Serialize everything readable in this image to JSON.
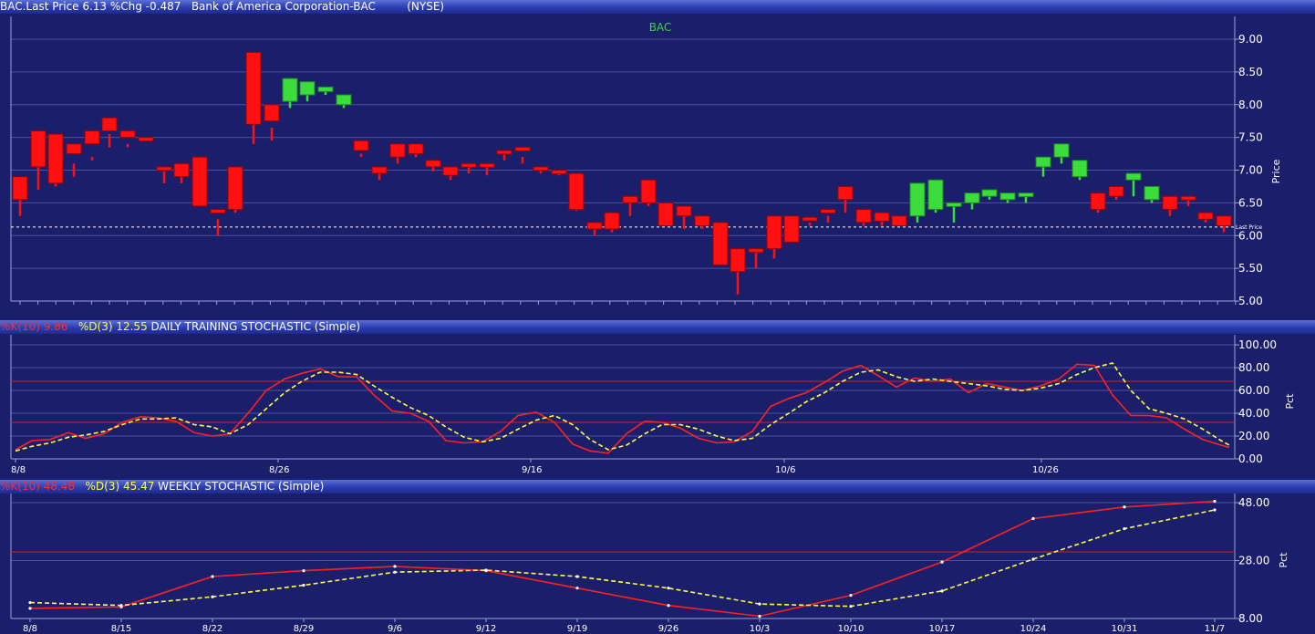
{
  "header": {
    "symbol_line": "BAC.Last Price 6.13 %Chg -0.487",
    "company": "Bank of America Corporation-BAC",
    "exchange": "(NYSE)"
  },
  "price_panel": {
    "title": "BAC",
    "axis_label": "Price",
    "last_price_label": "Last Price",
    "last_price": 6.13,
    "ticks": [
      "9.00",
      "8.50",
      "8.00",
      "7.50",
      "7.00",
      "6.50",
      "6.00",
      "5.50",
      "5.00"
    ]
  },
  "daily_panel": {
    "k_label": "%K(10) 9.86",
    "d_label": "%D(3) 12.55",
    "name": "DAILY TRAINING STOCHASTIC (Simple)",
    "axis_label": "Pct",
    "ticks": [
      "100.00",
      "80.00",
      "60.00",
      "40.00",
      "20.00",
      "0.00"
    ],
    "x_ticks": [
      "8/8",
      "8/26",
      "9/16",
      "10/6",
      "10/26"
    ]
  },
  "weekly_panel": {
    "k_label": "%K(10) 48.48",
    "d_label": "%D(3) 45.47",
    "name": "WEEKLY STOCHASTIC (Simple)",
    "axis_label": "Pct",
    "ticks": [
      "48.00",
      "28.00",
      "8.00"
    ],
    "x_ticks": [
      "8/8",
      "8/15",
      "8/22",
      "8/29",
      "9/6",
      "9/12",
      "9/19",
      "9/26",
      "10/3",
      "10/10",
      "10/17",
      "10/24",
      "10/31",
      "11/7"
    ]
  },
  "colors": {
    "background": "#1b1f6b",
    "up": "#3ddc3d",
    "down": "#ff1010",
    "k_line": "#ff2020",
    "d_line": "#ffff40",
    "title_green": "#3cd23c"
  },
  "chart_data": [
    {
      "type": "candlestick",
      "title": "BAC",
      "ylabel": "Price",
      "ylim": [
        5.0,
        9.0
      ],
      "last_price": 6.13,
      "ohlc": [
        [
          6.55,
          6.9,
          6.3,
          6.9,
          "down"
        ],
        [
          7.05,
          7.6,
          6.7,
          7.6,
          "down"
        ],
        [
          6.8,
          7.55,
          6.75,
          7.55,
          "down"
        ],
        [
          7.25,
          7.4,
          6.9,
          7.1,
          "down"
        ],
        [
          7.4,
          7.6,
          7.15,
          7.2,
          "down"
        ],
        [
          7.6,
          7.8,
          7.35,
          7.55,
          "down"
        ],
        [
          7.5,
          7.6,
          7.35,
          7.4,
          "down"
        ],
        [
          7.5,
          7.5,
          7.4,
          7.4,
          "down"
        ],
        [
          7.0,
          7.05,
          6.8,
          6.98,
          "down"
        ],
        [
          6.9,
          7.1,
          6.8,
          6.9,
          "down"
        ],
        [
          6.45,
          7.2,
          6.45,
          7.2,
          "down"
        ],
        [
          6.35,
          6.4,
          6.0,
          6.25,
          "down"
        ],
        [
          6.4,
          7.05,
          6.35,
          6.95,
          "down"
        ],
        [
          7.7,
          8.8,
          7.4,
          8.3,
          "down"
        ],
        [
          7.75,
          8.0,
          7.45,
          7.65,
          "down"
        ],
        [
          8.05,
          8.4,
          7.95,
          8.35,
          "up"
        ],
        [
          8.15,
          8.35,
          8.05,
          8.3,
          "up"
        ],
        [
          8.2,
          8.27,
          8.15,
          8.25,
          "up"
        ],
        [
          8.0,
          8.15,
          7.95,
          8.15,
          "up"
        ],
        [
          7.3,
          7.45,
          7.2,
          7.25,
          "down"
        ],
        [
          6.95,
          7.05,
          6.85,
          6.95,
          "down"
        ],
        [
          7.2,
          7.4,
          7.1,
          7.4,
          "down"
        ],
        [
          7.25,
          7.4,
          7.2,
          7.35,
          "down"
        ],
        [
          7.05,
          7.15,
          6.98,
          7.05,
          "down"
        ],
        [
          6.92,
          7.05,
          6.85,
          7.02,
          "down"
        ],
        [
          7.05,
          7.1,
          6.95,
          7.05,
          "down"
        ],
        [
          7.05,
          7.1,
          6.92,
          7.05,
          "down"
        ],
        [
          7.25,
          7.3,
          7.15,
          7.3,
          "down"
        ],
        [
          7.3,
          7.35,
          7.1,
          7.2,
          "down"
        ],
        [
          7.0,
          7.05,
          6.95,
          7.0,
          "down"
        ],
        [
          6.95,
          7.0,
          6.92,
          7.0,
          "down"
        ],
        [
          6.4,
          6.95,
          6.38,
          6.95,
          "down"
        ],
        [
          6.1,
          6.2,
          6.0,
          6.15,
          "down"
        ],
        [
          6.1,
          6.35,
          6.05,
          6.25,
          "down"
        ],
        [
          6.5,
          6.6,
          6.3,
          6.5,
          "down"
        ],
        [
          6.5,
          6.85,
          6.45,
          6.8,
          "down"
        ],
        [
          6.15,
          6.5,
          6.15,
          6.5,
          "down"
        ],
        [
          6.3,
          6.45,
          6.1,
          6.35,
          "down"
        ],
        [
          6.15,
          6.3,
          6.1,
          6.15,
          "down"
        ],
        [
          5.55,
          6.2,
          5.55,
          6.1,
          "down"
        ],
        [
          5.45,
          5.8,
          5.1,
          5.7,
          "down"
        ],
        [
          5.75,
          5.8,
          5.5,
          5.75,
          "down"
        ],
        [
          5.8,
          6.3,
          5.65,
          6.25,
          "down"
        ],
        [
          5.9,
          6.3,
          5.9,
          6.3,
          "down"
        ],
        [
          6.25,
          6.28,
          6.15,
          6.2,
          "down"
        ],
        [
          6.35,
          6.4,
          6.2,
          6.3,
          "down"
        ],
        [
          6.55,
          6.75,
          6.35,
          6.6,
          "down"
        ],
        [
          6.2,
          6.4,
          6.15,
          6.4,
          "down"
        ],
        [
          6.22,
          6.35,
          6.15,
          6.25,
          "down"
        ],
        [
          6.15,
          6.3,
          6.1,
          6.1,
          "down"
        ],
        [
          6.3,
          6.8,
          6.2,
          6.6,
          "up"
        ],
        [
          6.4,
          6.85,
          6.35,
          6.7,
          "up"
        ],
        [
          6.45,
          6.5,
          6.2,
          6.45,
          "up"
        ],
        [
          6.5,
          6.65,
          6.4,
          6.55,
          "up"
        ],
        [
          6.6,
          6.7,
          6.55,
          6.65,
          "up"
        ],
        [
          6.55,
          6.65,
          6.5,
          6.65,
          "up"
        ],
        [
          6.6,
          6.65,
          6.5,
          6.6,
          "up"
        ],
        [
          7.05,
          7.2,
          6.9,
          7.1,
          "up"
        ],
        [
          7.2,
          7.4,
          7.1,
          7.35,
          "up"
        ],
        [
          6.9,
          7.15,
          6.85,
          7.05,
          "up"
        ],
        [
          6.4,
          6.65,
          6.35,
          6.4,
          "down"
        ],
        [
          6.6,
          6.75,
          6.55,
          6.7,
          "down"
        ],
        [
          6.85,
          6.95,
          6.6,
          6.85,
          "up"
        ],
        [
          6.55,
          6.75,
          6.5,
          6.7,
          "up"
        ],
        [
          6.4,
          6.6,
          6.3,
          6.5,
          "down"
        ],
        [
          6.55,
          6.6,
          6.45,
          6.55,
          "down"
        ],
        [
          6.25,
          6.35,
          6.2,
          6.3,
          "down"
        ],
        [
          6.15,
          6.3,
          6.05,
          6.3,
          "down"
        ]
      ],
      "x_positions": [
        22,
        42,
        61,
        81,
        101,
        120,
        140,
        160,
        180,
        199,
        219,
        239,
        258,
        278,
        298,
        318,
        337,
        357,
        377,
        396,
        416,
        436,
        456,
        475,
        494,
        514,
        534,
        553,
        573,
        593,
        613,
        632,
        652,
        671,
        691,
        711,
        730,
        750,
        770,
        790,
        809,
        829,
        849,
        868,
        888,
        908,
        927,
        947,
        967,
        986,
        1006,
        1026,
        1046,
        1066,
        1085,
        1105,
        1125,
        1144,
        1164,
        1184,
        1204,
        1224,
        1243,
        1263,
        1283,
        1303,
        1322,
        1342
      ]
    },
    {
      "type": "line",
      "title": "DAILY TRAINING STOCHASTIC (Simple)",
      "ylabel": "Pct",
      "ylim": [
        0,
        100
      ],
      "reference_lines": [
        68,
        32
      ],
      "x_ticks": [
        "8/8",
        "8/26",
        "9/16",
        "10/6",
        "10/26"
      ],
      "series": [
        {
          "name": "%K(10) 9.86",
          "values": [
            8,
            16,
            17,
            23,
            18,
            22,
            32,
            37,
            36,
            33,
            23,
            20,
            22,
            40,
            60,
            70,
            75,
            79,
            72,
            72,
            56,
            42,
            40,
            33,
            16,
            14,
            15,
            24,
            38,
            41,
            32,
            13,
            7,
            5,
            22,
            33,
            32,
            27,
            18,
            14,
            15,
            24,
            46,
            53,
            58,
            67,
            77,
            82,
            73,
            63,
            71,
            68,
            70,
            58,
            66,
            63,
            60,
            64,
            70,
            83,
            82,
            56,
            38,
            38,
            36,
            26,
            17,
            12,
            10
          ],
          "x": [
            17,
            35,
            55,
            75,
            94,
            114,
            134,
            154,
            173,
            193,
            213,
            233,
            252,
            272,
            292,
            312,
            331,
            351,
            371,
            391,
            410,
            430,
            450,
            470,
            489,
            509,
            529,
            549,
            568,
            588,
            608,
            628,
            647,
            667,
            687,
            707,
            726,
            746,
            766,
            786,
            805,
            825,
            845,
            865,
            884,
            904,
            924,
            944,
            963,
            983,
            1003,
            1023,
            1042,
            1062,
            1082,
            1102,
            1121,
            1141,
            1161,
            1181,
            1200,
            1220,
            1240,
            1260,
            1279,
            1299,
            1319,
            1339,
            1348
          ]
        },
        {
          "name": "%D(3) 12.55",
          "values": [
            7,
            11,
            14,
            19,
            21,
            24,
            30,
            35,
            35,
            36,
            30,
            28,
            22,
            30,
            44,
            58,
            68,
            76,
            76,
            74,
            64,
            54,
            45,
            38,
            28,
            19,
            15,
            18,
            26,
            34,
            38,
            30,
            17,
            8,
            12,
            22,
            30,
            30,
            26,
            20,
            16,
            18,
            30,
            40,
            50,
            58,
            68,
            76,
            78,
            72,
            68,
            70,
            68,
            66,
            64,
            61,
            60,
            62,
            66,
            74,
            80,
            84,
            60,
            44,
            40,
            35,
            26,
            16,
            12
          ],
          "x": [
            17,
            35,
            55,
            75,
            94,
            114,
            134,
            154,
            173,
            193,
            213,
            233,
            252,
            272,
            292,
            312,
            331,
            351,
            371,
            391,
            410,
            430,
            450,
            470,
            489,
            509,
            529,
            549,
            568,
            588,
            608,
            628,
            647,
            667,
            687,
            707,
            726,
            746,
            766,
            786,
            805,
            825,
            845,
            865,
            884,
            904,
            924,
            944,
            963,
            983,
            1003,
            1023,
            1042,
            1062,
            1082,
            1102,
            1121,
            1141,
            1161,
            1181,
            1200,
            1220,
            1240,
            1260,
            1279,
            1299,
            1319,
            1339,
            1348
          ]
        }
      ]
    },
    {
      "type": "line",
      "title": "WEEKLY STOCHASTIC (Simple)",
      "ylabel": "Pct",
      "ylim": [
        8,
        50
      ],
      "reference_lines": [
        31
      ],
      "categories": [
        "8/8",
        "8/15",
        "8/22",
        "8/29",
        "9/6",
        "9/12",
        "9/19",
        "9/26",
        "10/3",
        "10/10",
        "10/17",
        "10/24",
        "10/31",
        "11/7"
      ],
      "series": [
        {
          "name": "%K(10) 48.48",
          "values": [
            11.5,
            12.0,
            22.5,
            24.5,
            26.0,
            24.5,
            18.5,
            12.5,
            8.8,
            16.0,
            27.5,
            42.5,
            46.5,
            48.48
          ]
        },
        {
          "name": "%D(3) 45.47",
          "values": [
            13.5,
            12.5,
            15.5,
            19.5,
            24.0,
            24.7,
            22.5,
            18.5,
            13.0,
            12.2,
            17.5,
            28.5,
            39.0,
            45.47
          ]
        }
      ]
    }
  ]
}
